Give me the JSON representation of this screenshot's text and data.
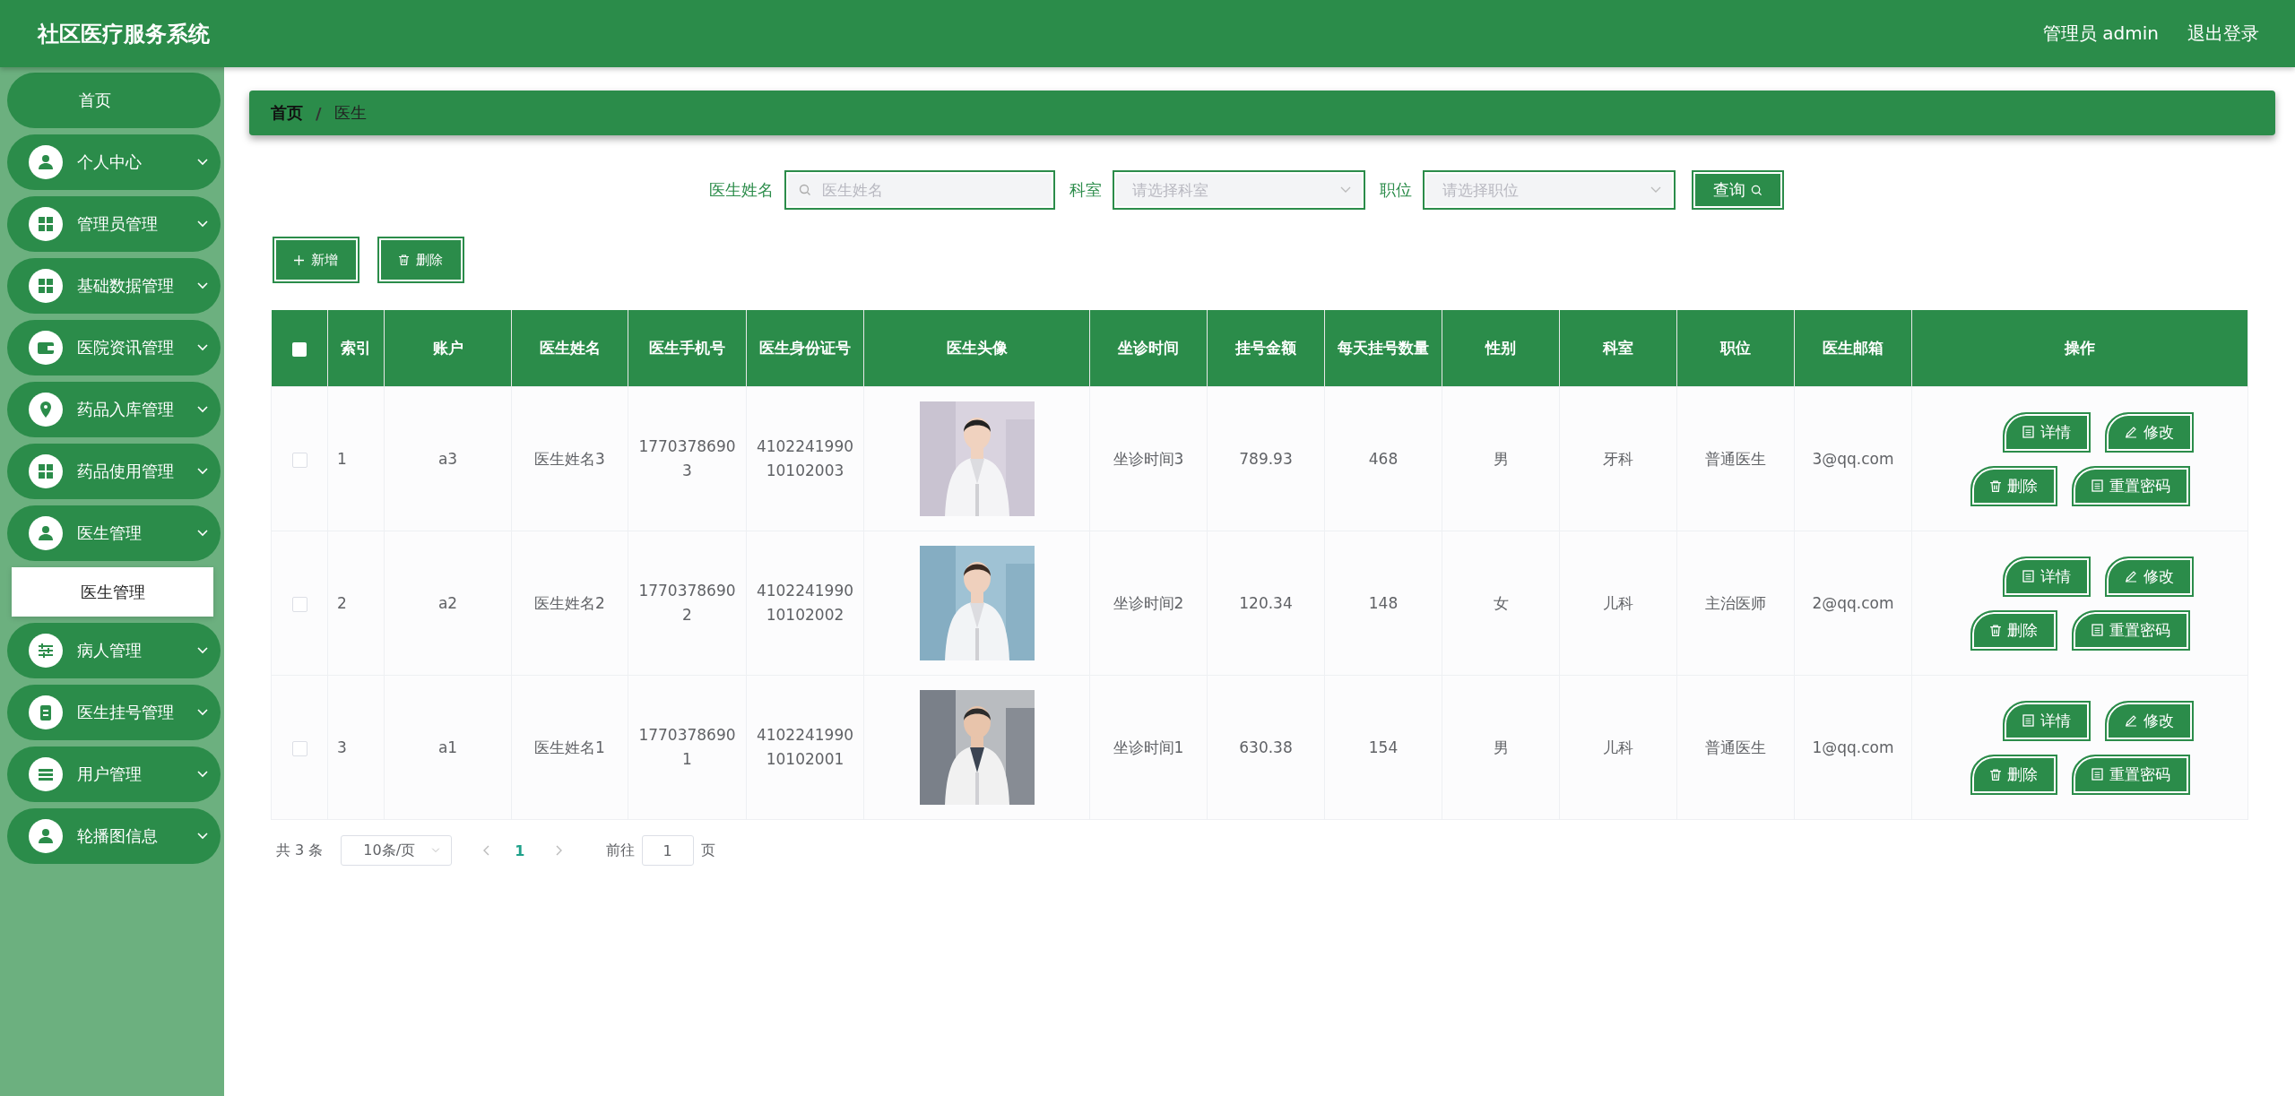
{
  "header": {
    "title": "社区医疗服务系统",
    "user": "管理员 admin",
    "logout": "退出登录"
  },
  "sidebar": {
    "items": [
      {
        "label": "首页",
        "has_icon": false
      },
      {
        "label": "个人中心",
        "has_icon": true
      },
      {
        "label": "管理员管理",
        "has_icon": true
      },
      {
        "label": "基础数据管理",
        "has_icon": true
      },
      {
        "label": "医院资讯管理",
        "has_icon": true
      },
      {
        "label": "药品入库管理",
        "has_icon": true
      },
      {
        "label": "药品使用管理",
        "has_icon": true
      },
      {
        "label": "医生管理",
        "has_icon": true,
        "children": [
          {
            "label": "医生管理"
          }
        ]
      },
      {
        "label": "病人管理",
        "has_icon": true
      },
      {
        "label": "医生挂号管理",
        "has_icon": true
      },
      {
        "label": "用户管理",
        "has_icon": true
      },
      {
        "label": "轮播图信息",
        "has_icon": true
      }
    ]
  },
  "breadcrumb": {
    "home": "首页",
    "separator": "/",
    "current": "医生"
  },
  "search": {
    "fields": [
      {
        "kind": "input",
        "label": "医生姓名",
        "placeholder": "医生姓名"
      },
      {
        "kind": "select",
        "label": "科室",
        "placeholder": "请选择科室"
      },
      {
        "kind": "select",
        "label": "职位",
        "placeholder": "请选择职位"
      }
    ],
    "button": "查询"
  },
  "toolbar": [
    {
      "kind": "add",
      "label": "新增"
    },
    {
      "kind": "delete",
      "label": "删除"
    }
  ],
  "table": {
    "select_all": {
      "checked": false
    },
    "columns": [
      "索引",
      "账户",
      "医生姓名",
      "医生手机号",
      "医生身份证号",
      "医生头像",
      "坐诊时间",
      "挂号金额",
      "每天挂号数量",
      "性别",
      "科室",
      "职位",
      "医生邮箱",
      "操作"
    ],
    "rows": [
      {
        "checked": false,
        "index": "1",
        "account": "a3",
        "name": "医生姓名3",
        "phone": "17703786903",
        "id_number": "410224199010102003",
        "hours": "坐诊时间3",
        "fee": "789.93",
        "daily_quota": "468",
        "gender": "男",
        "department": "牙科",
        "title": "普通医生",
        "email": "3@qq.com",
        "actions": [
          {
            "kind": "detail",
            "label": "详情"
          },
          {
            "kind": "edit",
            "label": "修改"
          },
          {
            "kind": "delete",
            "label": "删除"
          },
          {
            "kind": "reset",
            "label": "重置密码"
          }
        ]
      },
      {
        "checked": false,
        "index": "2",
        "account": "a2",
        "name": "医生姓名2",
        "phone": "17703786902",
        "id_number": "410224199010102002",
        "hours": "坐诊时间2",
        "fee": "120.34",
        "daily_quota": "148",
        "gender": "女",
        "department": "儿科",
        "title": "主治医师",
        "email": "2@qq.com",
        "actions": [
          {
            "kind": "detail",
            "label": "详情"
          },
          {
            "kind": "edit",
            "label": "修改"
          },
          {
            "kind": "delete",
            "label": "删除"
          },
          {
            "kind": "reset",
            "label": "重置密码"
          }
        ]
      },
      {
        "checked": false,
        "index": "3",
        "account": "a1",
        "name": "医生姓名1",
        "phone": "17703786901",
        "id_number": "410224199010102001",
        "hours": "坐诊时间1",
        "fee": "630.38",
        "daily_quota": "154",
        "gender": "男",
        "department": "儿科",
        "title": "普通医生",
        "email": "1@qq.com",
        "actions": [
          {
            "kind": "detail",
            "label": "详情"
          },
          {
            "kind": "edit",
            "label": "修改"
          },
          {
            "kind": "delete",
            "label": "删除"
          },
          {
            "kind": "reset",
            "label": "重置密码"
          }
        ]
      }
    ]
  },
  "pagination": {
    "total": "共 3 条",
    "page_size": "10条/页",
    "pages": [
      {
        "label": "1",
        "selected": true
      }
    ],
    "goto_label": "前往",
    "goto_value": "1",
    "goto_suffix": "页"
  }
}
